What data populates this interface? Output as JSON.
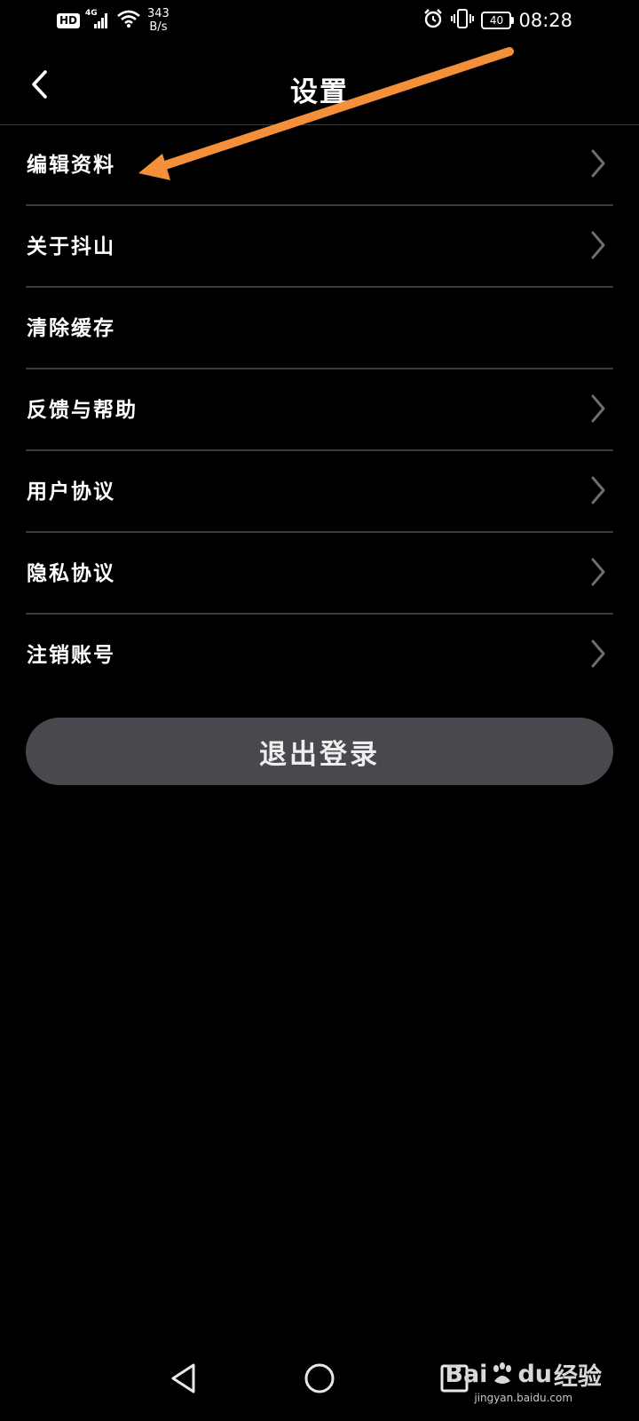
{
  "status_bar": {
    "hd": "HD",
    "network": "4G",
    "speed_value": "343",
    "speed_unit": "B/s",
    "battery": "40",
    "time": "08:28",
    "icons": [
      "signal-icon",
      "wifi-icon",
      "alarm-icon",
      "vibrate-icon",
      "battery-icon"
    ]
  },
  "header": {
    "title": "设置",
    "back_icon": "back-chevron-icon"
  },
  "menu": {
    "items": [
      {
        "label": "编辑资料",
        "chevron": true
      },
      {
        "label": "关于抖山",
        "chevron": true
      },
      {
        "label": "清除缓存",
        "chevron": false
      },
      {
        "label": "反馈与帮助",
        "chevron": true
      },
      {
        "label": "用户协议",
        "chevron": true
      },
      {
        "label": "隐私协议",
        "chevron": true
      },
      {
        "label": "注销账号",
        "chevron": true
      }
    ]
  },
  "logout_button": {
    "label": "退出登录"
  },
  "annotation": {
    "icon": "orange-arrow-icon",
    "color": "#f4903a"
  },
  "nav_bar": {
    "icons": [
      "back-triangle-icon",
      "home-circle-icon",
      "recent-square-icon"
    ]
  },
  "watermark": {
    "brand_a": "Bai",
    "brand_b": "du",
    "brand_c": "经验",
    "url": "jingyan.baidu.com"
  },
  "colors": {
    "background": "#000000",
    "divider": "#3b3b3b",
    "button_bg": "#4a474e",
    "arrow": "#f4903a"
  }
}
